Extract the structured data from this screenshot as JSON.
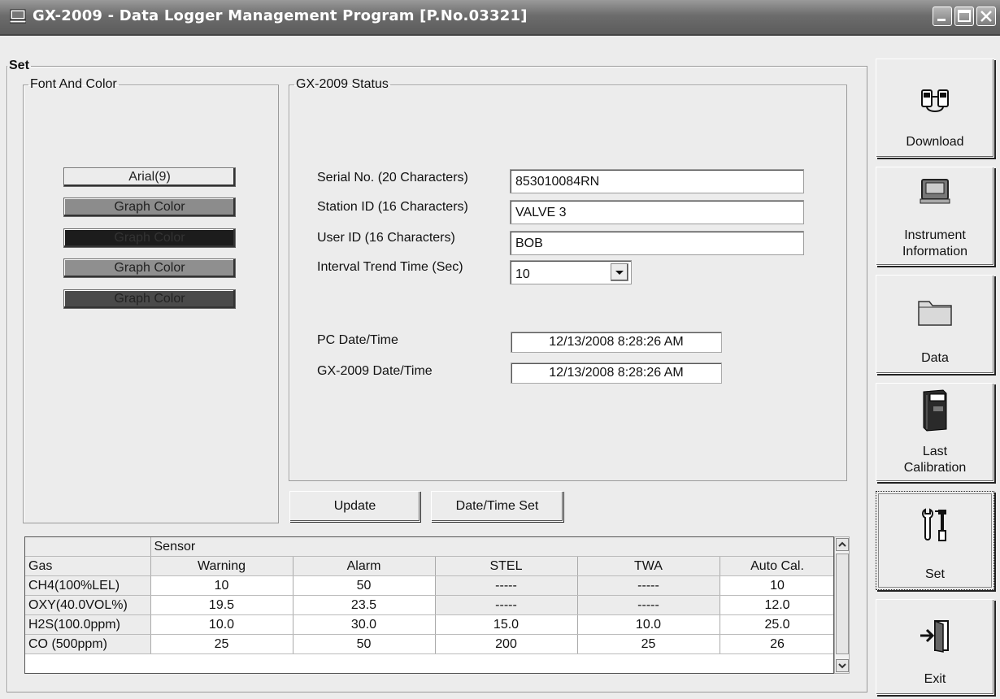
{
  "window": {
    "title": "GX-2009  - Data Logger Management Program [P.No.03321]"
  },
  "set_group": {
    "legend": "Set"
  },
  "font_color": {
    "legend": "Font And Color",
    "font_button": "Arial(9)",
    "graph_buttons": [
      {
        "label": "Graph Color",
        "color": "#8c8c8c"
      },
      {
        "label": "Graph Color",
        "color": "#1c1c1c"
      },
      {
        "label": "Graph Color",
        "color": "#8f8f8f"
      },
      {
        "label": "Graph Color",
        "color": "#4a4a4a"
      }
    ]
  },
  "status": {
    "legend": "GX-2009 Status",
    "serial_label": "Serial No. (20 Characters)",
    "serial_value": "853010084RN",
    "station_label": "Station ID (16 Characters)",
    "station_value": "VALVE 3",
    "user_label": "User ID (16 Characters)",
    "user_value": "BOB",
    "interval_label": "Interval Trend Time (Sec)",
    "interval_value": "10",
    "pc_dt_label": "PC Date/Time",
    "pc_dt_value": "12/13/2008 8:28:26 AM",
    "gx_dt_label": "GX-2009 Date/Time",
    "gx_dt_value": "12/13/2008 8:28:26 AM"
  },
  "actions": {
    "update": "Update",
    "datetime_set": "Date/Time Set"
  },
  "table": {
    "group_header": "Sensor",
    "columns": [
      "Gas",
      "Warning",
      "Alarm",
      "STEL",
      "TWA",
      "Auto Cal."
    ],
    "rows": [
      [
        "CH4(100%LEL)",
        "10",
        "50",
        "-----",
        "-----",
        "10"
      ],
      [
        "OXY(40.0VOL%)",
        "19.5",
        "23.5",
        "-----",
        "-----",
        "12.0"
      ],
      [
        "H2S(100.0ppm)",
        "10.0",
        "30.0",
        "15.0",
        "10.0",
        "25.0"
      ],
      [
        "CO (500ppm)",
        "25",
        "50",
        "200",
        "25",
        "26"
      ]
    ]
  },
  "sidebar": {
    "download": "Download",
    "instrument_1": "Instrument",
    "instrument_2": "Information",
    "data": "Data",
    "calib_1": "Last",
    "calib_2": "Calibration",
    "set": "Set",
    "exit": "Exit"
  }
}
